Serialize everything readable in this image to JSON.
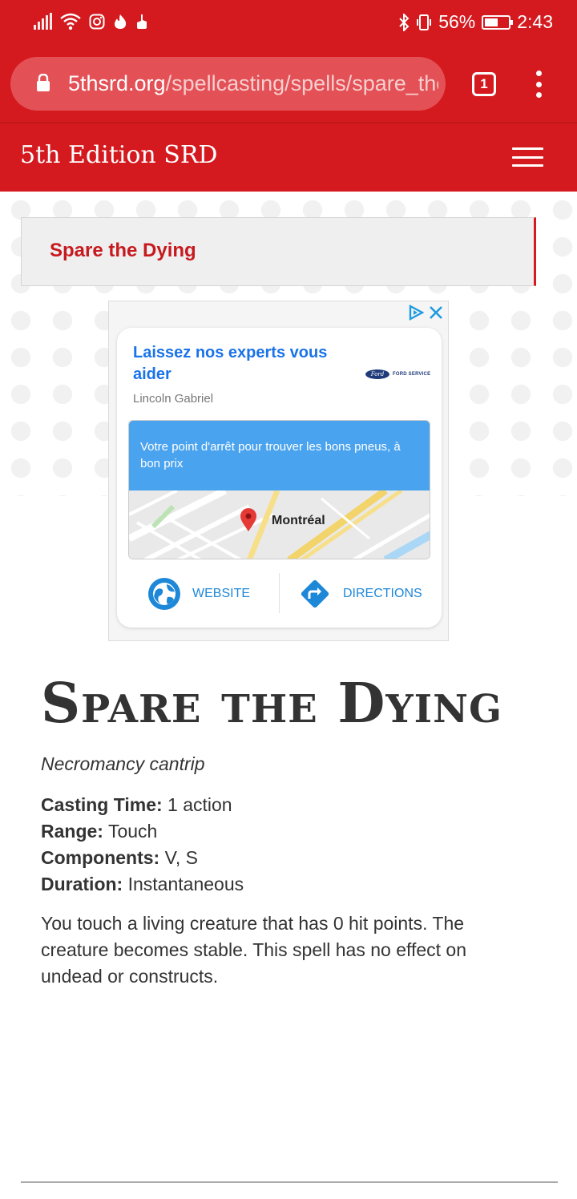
{
  "status_bar": {
    "battery": "56%",
    "battery_level": 0.56,
    "time": "2:43"
  },
  "browser": {
    "url_domain": "5thsrd.org",
    "url_path": "/spellcasting/spells/spare_the_dying",
    "tab_count": "1"
  },
  "site": {
    "title": "5th Edition SRD"
  },
  "breadcrumb": {
    "label": "Spare the Dying"
  },
  "ad": {
    "headline": "Laissez nos experts vous aider",
    "advertiser": "Lincoln Gabriel",
    "brand_logo": "Ford",
    "brand_service": "FORD SERVICE",
    "map_caption": "Votre point d'arrêt pour trouver les bons pneus, à bon prix",
    "map_label": "Montréal",
    "website_label": "WEBSITE",
    "directions_label": "DIRECTIONS"
  },
  "spell": {
    "title": "Spare the Dying",
    "school": "Necromancy cantrip",
    "casting_time_label": "Casting Time:",
    "casting_time": "1 action",
    "range_label": "Range:",
    "range": "Touch",
    "components_label": "Components:",
    "components": "V, S",
    "duration_label": "Duration:",
    "duration": "Instantaneous",
    "description": "You touch a living creature that has 0 hit points. The creature becomes stable. This spell has no effect on undead or constructs."
  },
  "colors": {
    "primary_red": "#d41a1f",
    "link_red": "#c61a1f",
    "ad_blue": "#1a73e8"
  }
}
